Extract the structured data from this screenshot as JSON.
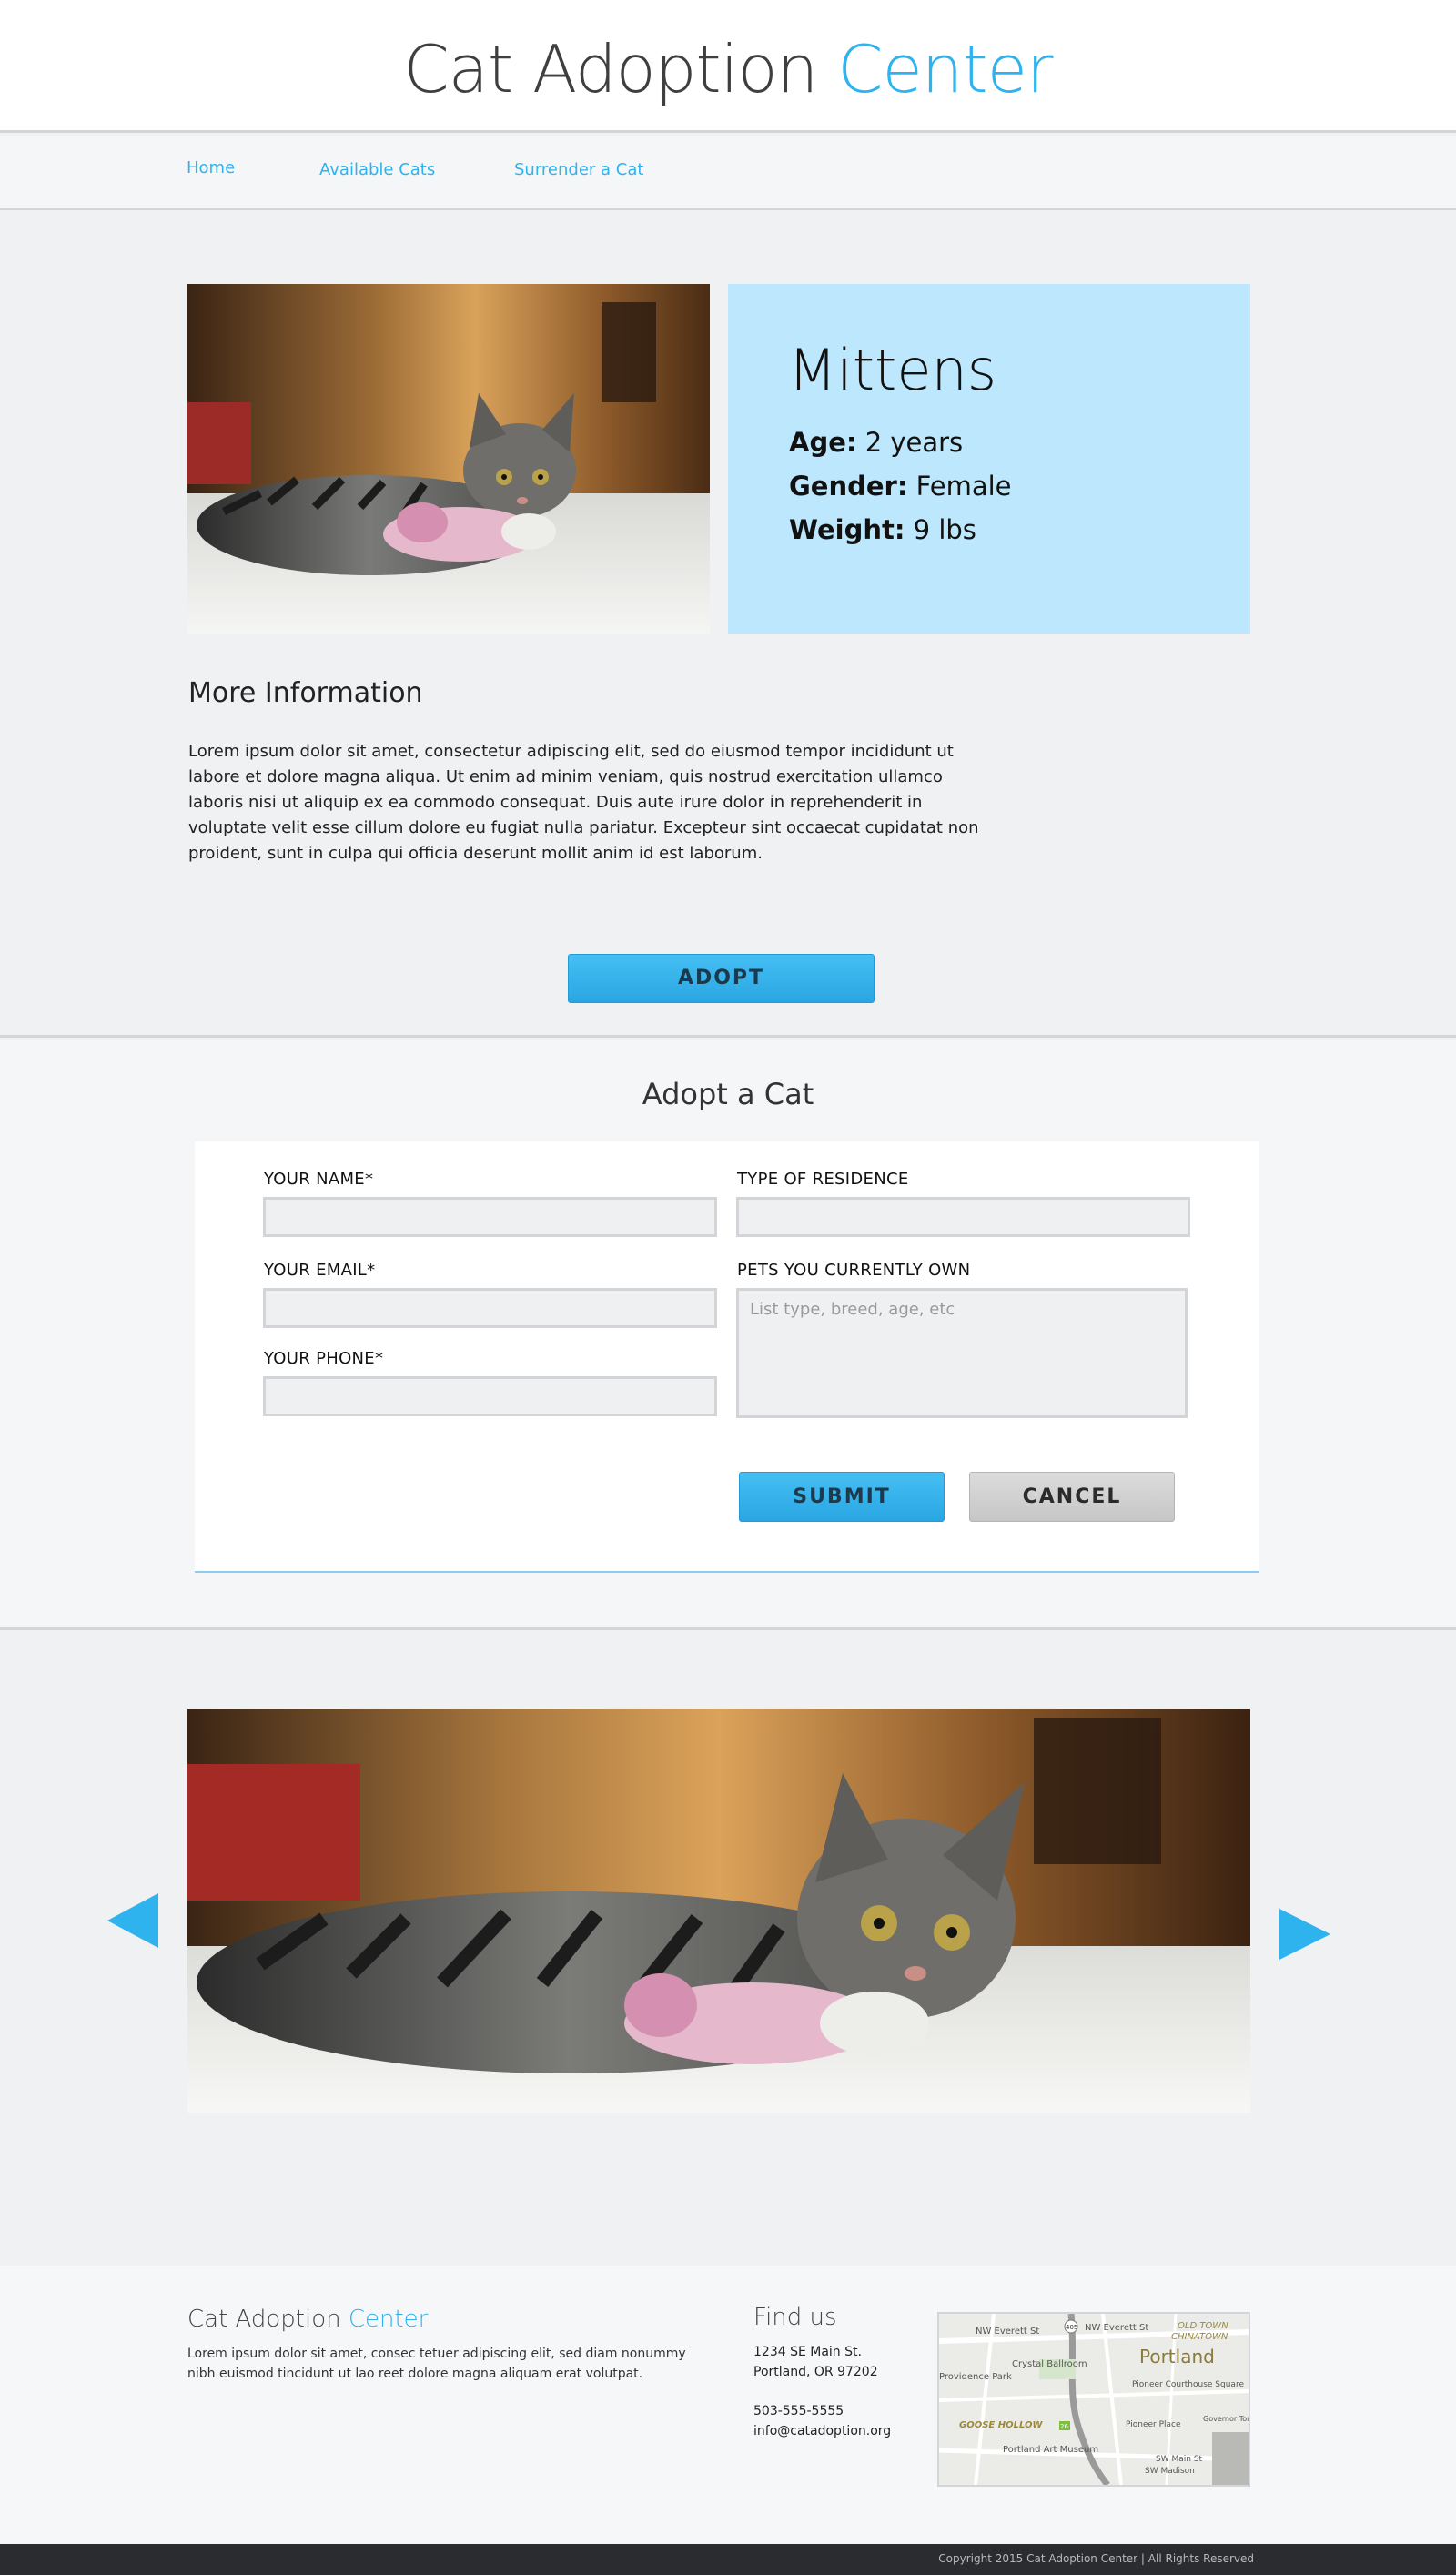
{
  "header": {
    "title_main": "Cat Adoption ",
    "title_accent": "Center"
  },
  "nav": {
    "items": [
      {
        "label": "Home"
      },
      {
        "label": "Available Cats"
      },
      {
        "label": "Surrender a Cat"
      }
    ]
  },
  "profile": {
    "name": "Mittens",
    "age_label": "Age:",
    "age_value": "2 years",
    "gender_label": "Gender:",
    "gender_value": "Female",
    "weight_label": "Weight:",
    "weight_value": "9 lbs",
    "more_title": "More Information",
    "more_text": "Lorem ipsum dolor sit amet, consectetur adipiscing elit, sed do eiusmod tempor incididunt ut labore et dolore magna aliqua. Ut enim ad minim veniam, quis nostrud exercitation ullamco laboris nisi ut aliquip ex ea commodo consequat. Duis aute irure dolor in reprehenderit in voluptate velit esse cillum dolore eu fugiat nulla pariatur. Excepteur sint occaecat cupidatat non proident, sunt in culpa qui officia deserunt mollit anim id est laborum.",
    "adopt_label": "ADOPT"
  },
  "form": {
    "title": "Adopt a Cat",
    "name_label": "YOUR NAME*",
    "name_value": "",
    "email_label": "YOUR EMAIL*",
    "email_value": "",
    "phone_label": "YOUR PHONE*",
    "phone_value": "",
    "residence_label": "TYPE OF RESIDENCE",
    "residence_value": "",
    "pets_label": "PETS YOU CURRENTLY OWN",
    "pets_placeholder": "List type, breed, age, etc",
    "submit_label": "SUBMIT",
    "cancel_label": "CANCEL"
  },
  "footer": {
    "title_main": "Cat Adoption ",
    "title_accent": "Center",
    "text": "Lorem ipsum dolor sit amet, consec tetuer adipiscing elit, sed diam nonummy nibh euismod tincidunt ut lao reet dolore magna aliquam erat volutpat.",
    "find_title": "Find us",
    "address_1": "1234 SE Main St.",
    "address_2": "Portland, OR 97202",
    "phone": "503-555-5555",
    "email": "info@catadoption.org",
    "map": {
      "city": "Portland",
      "labels": [
        "NW Everett St",
        "NW Everett St",
        "OLD TOWN",
        "CHINATOWN",
        "Crystal Ballroom",
        "Providence Park",
        "Pioneer Courthouse Square",
        "Pioneer Place",
        "GOOSE HOLLOW",
        "Portland Art Museum",
        "Governor Tom McCall Waterfront",
        "SW Main St",
        "SW Madison",
        "405",
        "26"
      ]
    }
  },
  "copyright": "Copyright 2015 Cat Adoption Center | All Rights Reserved",
  "colors": {
    "accent": "#2fb3ee",
    "info_box": "#bce7fc",
    "cancel": "#cfcfcf",
    "footer_bar": "#2a2c30"
  }
}
